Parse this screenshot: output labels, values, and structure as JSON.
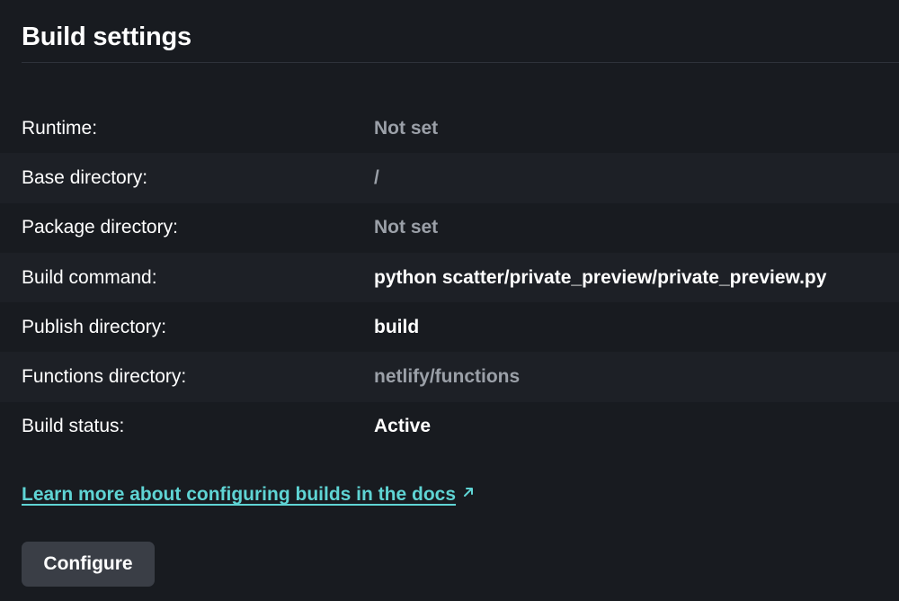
{
  "header": {
    "title": "Build settings"
  },
  "settings": [
    {
      "label": "Runtime:",
      "value": "Not set",
      "style": "muted"
    },
    {
      "label": "Base directory:",
      "value": "/",
      "style": "muted"
    },
    {
      "label": "Package directory:",
      "value": "Not set",
      "style": "muted"
    },
    {
      "label": "Build command:",
      "value": "python scatter/private_preview/private_preview.py",
      "style": "strong"
    },
    {
      "label": "Publish directory:",
      "value": "build",
      "style": "strong"
    },
    {
      "label": "Functions directory:",
      "value": "netlify/functions",
      "style": "muted"
    },
    {
      "label": "Build status:",
      "value": "Active",
      "style": "strong"
    }
  ],
  "docs_link": {
    "text": "Learn more about configuring builds in the docs",
    "icon": "external-link-arrow-icon"
  },
  "configure_button": {
    "label": "Configure"
  },
  "colors": {
    "background": "#181b20",
    "row_alt": "#1d2026",
    "muted_text": "#9ba0a8",
    "link": "#5fd4d4",
    "button_bg": "#3a3e46"
  }
}
